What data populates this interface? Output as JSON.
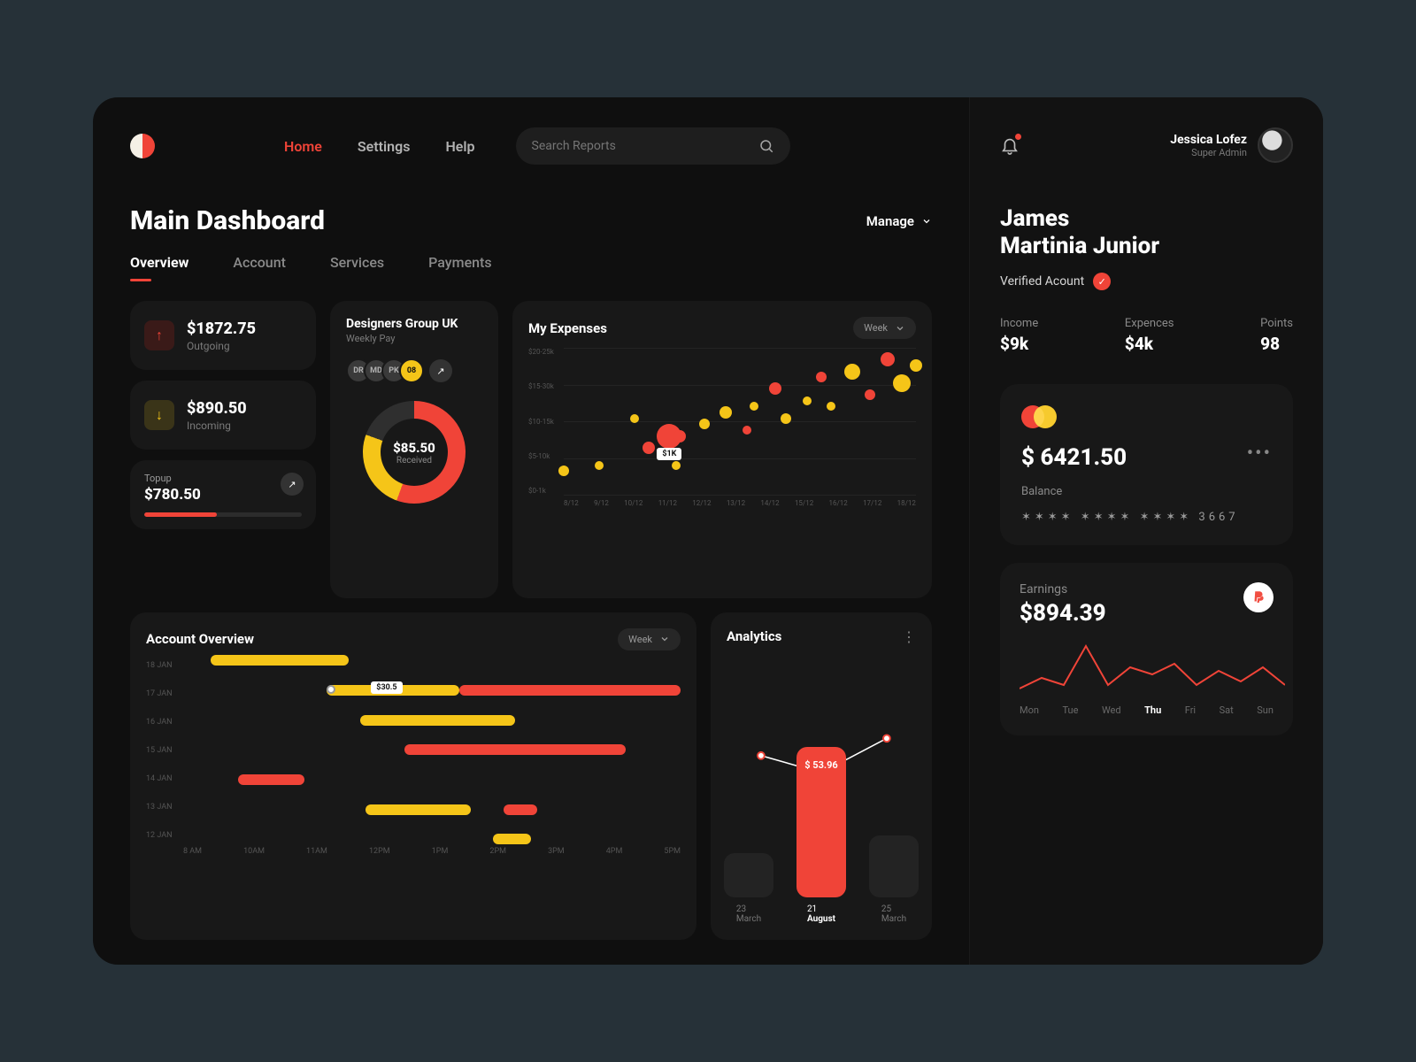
{
  "nav": {
    "items": [
      "Home",
      "Settings",
      "Help"
    ],
    "active": 0
  },
  "search": {
    "placeholder": "Search Reports"
  },
  "page": {
    "title": "Main Dashboard",
    "manage": "Manage"
  },
  "tabs": {
    "items": [
      "Overview",
      "Account",
      "Services",
      "Payments"
    ],
    "active": 0
  },
  "stats": {
    "outgoing": {
      "amount": "$1872.75",
      "label": "Outgoing"
    },
    "incoming": {
      "amount": "$890.50",
      "label": "Incoming"
    }
  },
  "topup": {
    "label": "Topup",
    "amount": "$780.50"
  },
  "designers": {
    "title": "Designers Group UK",
    "subtitle": "Weekly Pay",
    "avatars": [
      "DR",
      "MD",
      "PK"
    ],
    "badge": "08",
    "received": {
      "amount": "$85.50",
      "label": "Received"
    }
  },
  "expenses": {
    "title": "My Expenses",
    "range": "Week",
    "tooltip": "$1K"
  },
  "overview": {
    "title": "Account Overview",
    "range": "Week",
    "tooltip": "$30.5"
  },
  "analytics": {
    "title": "Analytics",
    "highlight": "$ 53.96",
    "cols": [
      {
        "d1": "23",
        "d2": "March"
      },
      {
        "d1": "21",
        "d2": "August"
      },
      {
        "d1": "25",
        "d2": "March"
      }
    ]
  },
  "side": {
    "user": {
      "name": "Jessica Lofez",
      "role": "Super Admin"
    },
    "account": {
      "name1": "James",
      "name2": "Martinia Junior",
      "verified": "Verified Acount"
    },
    "metrics": {
      "income": {
        "label": "Income",
        "value": "$9k"
      },
      "expenses": {
        "label": "Expences",
        "value": "$4k"
      },
      "points": {
        "label": "Points",
        "value": "98"
      }
    },
    "card": {
      "balance": "$ 6421.50",
      "label": "Balance",
      "number": "✶✶✶✶  ✶✶✶✶  ✶✶✶✶  3667"
    },
    "earnings": {
      "label": "Earnings",
      "amount": "$894.39",
      "days": [
        "Mon",
        "Tue",
        "Wed",
        "Thu",
        "Fri",
        "Sat",
        "Sun"
      ],
      "activeDay": 3
    }
  },
  "chart_data": [
    {
      "type": "scatter",
      "title": "My Expenses",
      "ylabels": [
        "$20-25k",
        "$15-30k",
        "$10-15k",
        "$5-10k",
        "$0-1k"
      ],
      "xlabels": [
        "8/12",
        "9/12",
        "10/12",
        "11/12",
        "12/12",
        "13/12",
        "14/12",
        "15/12",
        "16/12",
        "17/12",
        "18/12"
      ],
      "points": [
        {
          "x": 0,
          "y": 4,
          "c": "#f5c518",
          "s": 6
        },
        {
          "x": 1,
          "y": 5,
          "c": "#f5c518",
          "s": 5
        },
        {
          "x": 2,
          "y": 13,
          "c": "#f5c518",
          "s": 5
        },
        {
          "x": 2.4,
          "y": 8,
          "c": "#f04438",
          "s": 7
        },
        {
          "x": 3,
          "y": 10,
          "c": "#f04438",
          "s": 14
        },
        {
          "x": 3.3,
          "y": 10,
          "c": "#f04438",
          "s": 7
        },
        {
          "x": 3.2,
          "y": 5,
          "c": "#f5c518",
          "s": 5
        },
        {
          "x": 4,
          "y": 12,
          "c": "#f5c518",
          "s": 6
        },
        {
          "x": 4.6,
          "y": 14,
          "c": "#f5c518",
          "s": 7
        },
        {
          "x": 5.2,
          "y": 11,
          "c": "#f04438",
          "s": 5
        },
        {
          "x": 5.4,
          "y": 15,
          "c": "#f5c518",
          "s": 5
        },
        {
          "x": 6,
          "y": 18,
          "c": "#f04438",
          "s": 7
        },
        {
          "x": 6.3,
          "y": 13,
          "c": "#f5c518",
          "s": 6
        },
        {
          "x": 6.9,
          "y": 16,
          "c": "#f5c518",
          "s": 5
        },
        {
          "x": 7.3,
          "y": 20,
          "c": "#f04438",
          "s": 6
        },
        {
          "x": 7.6,
          "y": 15,
          "c": "#f5c518",
          "s": 5
        },
        {
          "x": 8.2,
          "y": 21,
          "c": "#f5c518",
          "s": 9
        },
        {
          "x": 8.7,
          "y": 17,
          "c": "#f04438",
          "s": 6
        },
        {
          "x": 9.2,
          "y": 23,
          "c": "#f04438",
          "s": 8
        },
        {
          "x": 9.6,
          "y": 19,
          "c": "#f5c518",
          "s": 10
        },
        {
          "x": 10,
          "y": 22,
          "c": "#f5c518",
          "s": 7
        }
      ],
      "xlim": [
        0,
        10
      ],
      "ylim": [
        0,
        25
      ],
      "tooltip": {
        "x": 3,
        "y": 7,
        "text": "$1K"
      }
    },
    {
      "type": "gantt",
      "title": "Account Overview",
      "ylabels": [
        "18 JAN",
        "17 JAN",
        "16 JAN",
        "15 JAN",
        "14 JAN",
        "13 JAN",
        "12 JAN"
      ],
      "xlabels": [
        "8 AM",
        "10AM",
        "11AM",
        "12PM",
        "1PM",
        "2PM",
        "3PM",
        "4PM",
        "5PM"
      ],
      "bars": [
        {
          "row": 0,
          "x0": 8.5,
          "x1": 11.0,
          "c": "y"
        },
        {
          "row": 1,
          "x0": 10.6,
          "x1": 13.0,
          "c": "y"
        },
        {
          "row": 1,
          "x0": 13.0,
          "x1": 17.0,
          "c": "r"
        },
        {
          "row": 2,
          "x0": 11.2,
          "x1": 14.0,
          "c": "y"
        },
        {
          "row": 3,
          "x0": 12.0,
          "x1": 16.0,
          "c": "r"
        },
        {
          "row": 4,
          "x0": 9.0,
          "x1": 10.2,
          "c": "r"
        },
        {
          "row": 5,
          "x0": 11.3,
          "x1": 13.2,
          "c": "y"
        },
        {
          "row": 5,
          "x0": 13.8,
          "x1": 14.4,
          "c": "r"
        },
        {
          "row": 6,
          "x0": 13.6,
          "x1": 14.3,
          "c": "y"
        }
      ],
      "xlim": [
        8,
        17
      ],
      "tooltip": {
        "row": 1,
        "x": 11.4,
        "text": "$30.5"
      }
    },
    {
      "type": "bar",
      "title": "Analytics",
      "categories": [
        "23 March",
        "21 August",
        "25 March"
      ],
      "values": [
        30,
        100,
        42
      ],
      "highlight": {
        "index": 1,
        "label": "$ 53.96"
      },
      "line": [
        44,
        32,
        58
      ]
    },
    {
      "type": "pie",
      "title": "Designers Group UK — Received",
      "slices": [
        {
          "name": "red",
          "value": 56
        },
        {
          "name": "yellow",
          "value": 25
        },
        {
          "name": "empty",
          "value": 19
        }
      ],
      "center": "$85.50"
    },
    {
      "type": "line",
      "title": "Earnings",
      "categories": [
        "Mon",
        "Tue",
        "Wed",
        "Thu",
        "Fri",
        "Sat",
        "Sun"
      ],
      "values": [
        28,
        34,
        30,
        52,
        30,
        40,
        36,
        42,
        30,
        38,
        32,
        40,
        30
      ]
    }
  ]
}
